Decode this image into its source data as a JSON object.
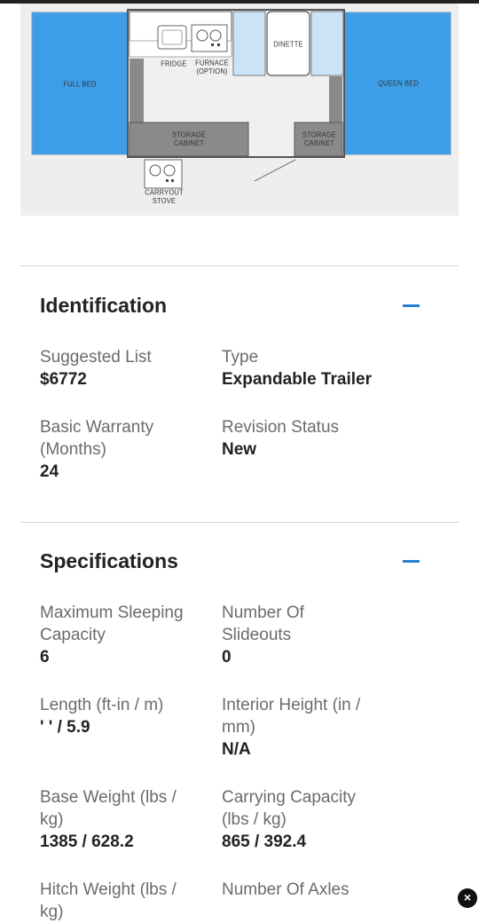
{
  "floorplan": {
    "labels": {
      "full_bed": "FULL BED",
      "queen_bed": "QUEEN BED",
      "fridge": "FRIDGE",
      "furnace": "FURNACE (OPTION)",
      "dinette": "DINETTE",
      "storage_left": "STORAGE CABINET",
      "storage_right": "STORAGE CABINET",
      "carryout": "CARRYOUT STOVE"
    }
  },
  "identification": {
    "title": "Identification",
    "suggested_list_label": "Suggested List",
    "suggested_list_value": "$6772",
    "type_label": "Type",
    "type_value": "Expandable Trailer",
    "warranty_label": "Basic Warranty (Months)",
    "warranty_value": "24",
    "revision_label": "Revision Status",
    "revision_value": "New"
  },
  "specifications": {
    "title": "Specifications",
    "sleeping_label": "Maximum Sleeping Capacity",
    "sleeping_value": "6",
    "slideouts_label": "Number Of Slideouts",
    "slideouts_value": "0",
    "length_label": "Length (ft-in / m)",
    "length_value": "' ' / 5.9",
    "interior_label": "Interior Height (in / mm)",
    "interior_value": "N/A",
    "base_weight_label": "Base Weight (lbs / kg)",
    "base_weight_value": "1385 / 628.2",
    "carrying_label": "Carrying Capacity (lbs / kg)",
    "carrying_value": "865 / 392.4",
    "hitch_label": "Hitch Weight (lbs / kg)",
    "axles_label": "Number Of Axles"
  }
}
